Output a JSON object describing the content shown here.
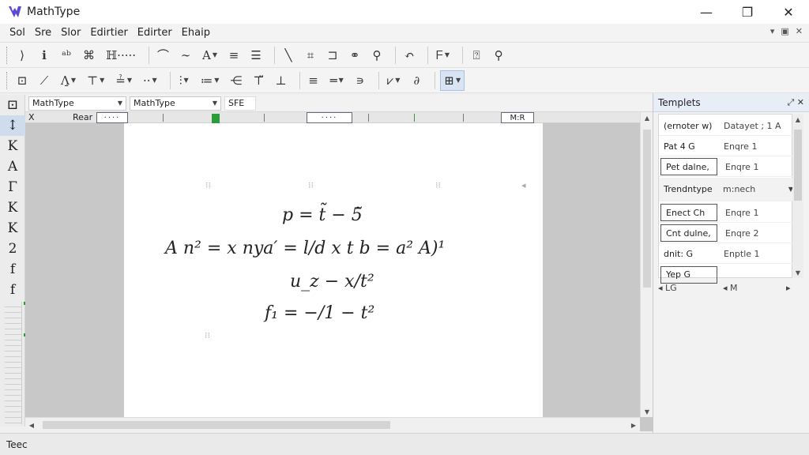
{
  "window": {
    "title": "MathType",
    "minimize": "—",
    "maximize": "❐",
    "close": "✕"
  },
  "menu": {
    "items": [
      "Sol",
      "Sre",
      "Slor",
      "Edirtier",
      "Edirter",
      "Ehaip"
    ],
    "right_icons": [
      "▾",
      "▣",
      "✕"
    ]
  },
  "toolbar1": {
    "buttons": [
      "⟩",
      "ℹ",
      "ᵃᵇ",
      "⌘",
      "ℍ·····",
      "⌒",
      "∼",
      "A",
      "≡",
      "☰",
      "╲",
      "⌗",
      "⊐",
      "⚭",
      "⚲",
      "↶",
      "ᖴ",
      "⍰",
      "⚲"
    ]
  },
  "toolbar2": {
    "buttons": [
      "⊡",
      "⟋",
      "Λ̱",
      "⊤",
      "≟",
      "··",
      "⫶",
      "≔",
      "⋲",
      "⊤̈",
      "⊥",
      "≡",
      "═",
      "∍",
      "⩗",
      "∂",
      "⊞"
    ]
  },
  "left_palette": {
    "items": [
      "⊡",
      "↕",
      "K",
      "A",
      "Γ",
      "K",
      "K",
      "2",
      "f",
      "f"
    ]
  },
  "doc": {
    "font_select": "MathType",
    "size_select": "MathType",
    "style_label": "SFE",
    "ruler_left_a": "X",
    "ruler_left_b": "Rear",
    "ruler_box1": "····",
    "ruler_box2": "····",
    "ruler_right": "M:R",
    "equation_lines": [
      "p = t̃ − 5̃",
      "A  n² = x nya′ = l/d  x t  b = a²  A)¹",
      "u_z − x/t²",
      "f₁ = −/1 − t²"
    ]
  },
  "templates": {
    "title": "Templets",
    "rows": [
      {
        "left": "(ernoter w)",
        "right": "Datayet ; 1 A"
      },
      {
        "left": "Pat 4 G",
        "right": "Enqre 1"
      },
      {
        "left": "Pet dalne,",
        "right": "Enqre 1"
      },
      {
        "left": "Trendntype",
        "right": "m:nech"
      },
      {
        "left": "Enect Ch",
        "right": "Enqre 1"
      },
      {
        "left": "Cnt dulne,",
        "right": "Enqre 2"
      },
      {
        "left": "dnit: G",
        "right": "Enptle 1"
      },
      {
        "left": "Yep G",
        "right": ""
      }
    ],
    "footer_left": "◂ LG",
    "footer_mid": "◂ M",
    "footer_right": "▸"
  },
  "status": {
    "text": "Teec"
  }
}
